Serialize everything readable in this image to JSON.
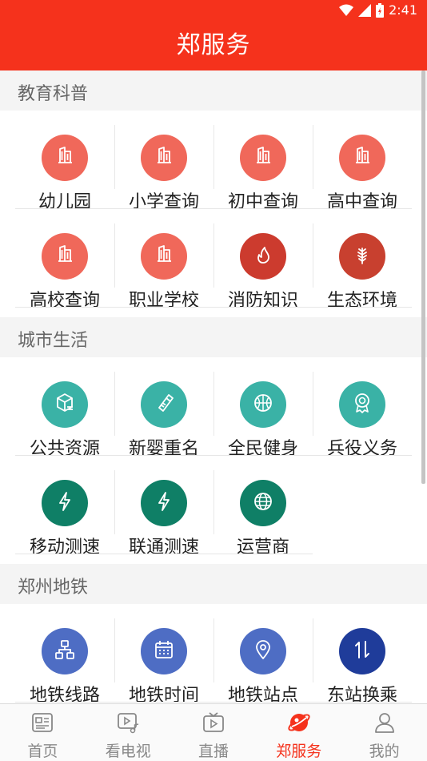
{
  "status_bar": {
    "time": "2:41"
  },
  "header": {
    "title": "郑服务"
  },
  "sections": [
    {
      "title": "教育科普",
      "items": [
        {
          "label": "幼儿园",
          "icon": "building-icon",
          "color": "#f0685a"
        },
        {
          "label": "小学查询",
          "icon": "building-icon",
          "color": "#f0685a"
        },
        {
          "label": "初中查询",
          "icon": "building-icon",
          "color": "#f0685a"
        },
        {
          "label": "高中查询",
          "icon": "building-icon",
          "color": "#f0685a"
        },
        {
          "label": "高校查询",
          "icon": "building-icon",
          "color": "#f0685a"
        },
        {
          "label": "职业学校",
          "icon": "building-icon",
          "color": "#f0685a"
        },
        {
          "label": "消防知识",
          "icon": "flame-icon",
          "color": "#cc3b2e"
        },
        {
          "label": "生态环境",
          "icon": "leaf-icon",
          "color": "#c8402f"
        }
      ]
    },
    {
      "title": "城市生活",
      "items": [
        {
          "label": "公共资源",
          "icon": "cube-icon",
          "color": "#3ab2a6"
        },
        {
          "label": "新婴重名",
          "icon": "baby-bottle-icon",
          "color": "#3ab2a6"
        },
        {
          "label": "全民健身",
          "icon": "ball-icon",
          "color": "#3ab2a6"
        },
        {
          "label": "兵役义务",
          "icon": "medal-icon",
          "color": "#3ab2a6"
        },
        {
          "label": "移动测速",
          "icon": "lightning-icon",
          "color": "#0f7f66"
        },
        {
          "label": "联通测速",
          "icon": "lightning-icon",
          "color": "#0f7f66"
        },
        {
          "label": "运营商",
          "icon": "globe-icon",
          "color": "#0f7f66"
        }
      ]
    },
    {
      "title": "郑州地铁",
      "items": [
        {
          "label": "地铁线路",
          "icon": "route-map-icon",
          "color": "#4e6dc4"
        },
        {
          "label": "地铁时间",
          "icon": "calendar-icon",
          "color": "#4e6dc4"
        },
        {
          "label": "地铁站点",
          "icon": "location-pin-icon",
          "color": "#4e6dc4"
        },
        {
          "label": "东站换乘",
          "icon": "transfer-arrows-icon",
          "color": "#1f3c9a"
        }
      ]
    }
  ],
  "tabs": [
    {
      "label": "首页",
      "icon": "news-icon",
      "active": false
    },
    {
      "label": "看电视",
      "icon": "tv-music-icon",
      "active": false
    },
    {
      "label": "直播",
      "icon": "live-tv-icon",
      "active": false
    },
    {
      "label": "郑服务",
      "icon": "planet-icon",
      "active": true
    },
    {
      "label": "我的",
      "icon": "person-icon",
      "active": false
    }
  ],
  "colors": {
    "brand_red": "#f5321c",
    "tab_inactive": "#888888"
  }
}
